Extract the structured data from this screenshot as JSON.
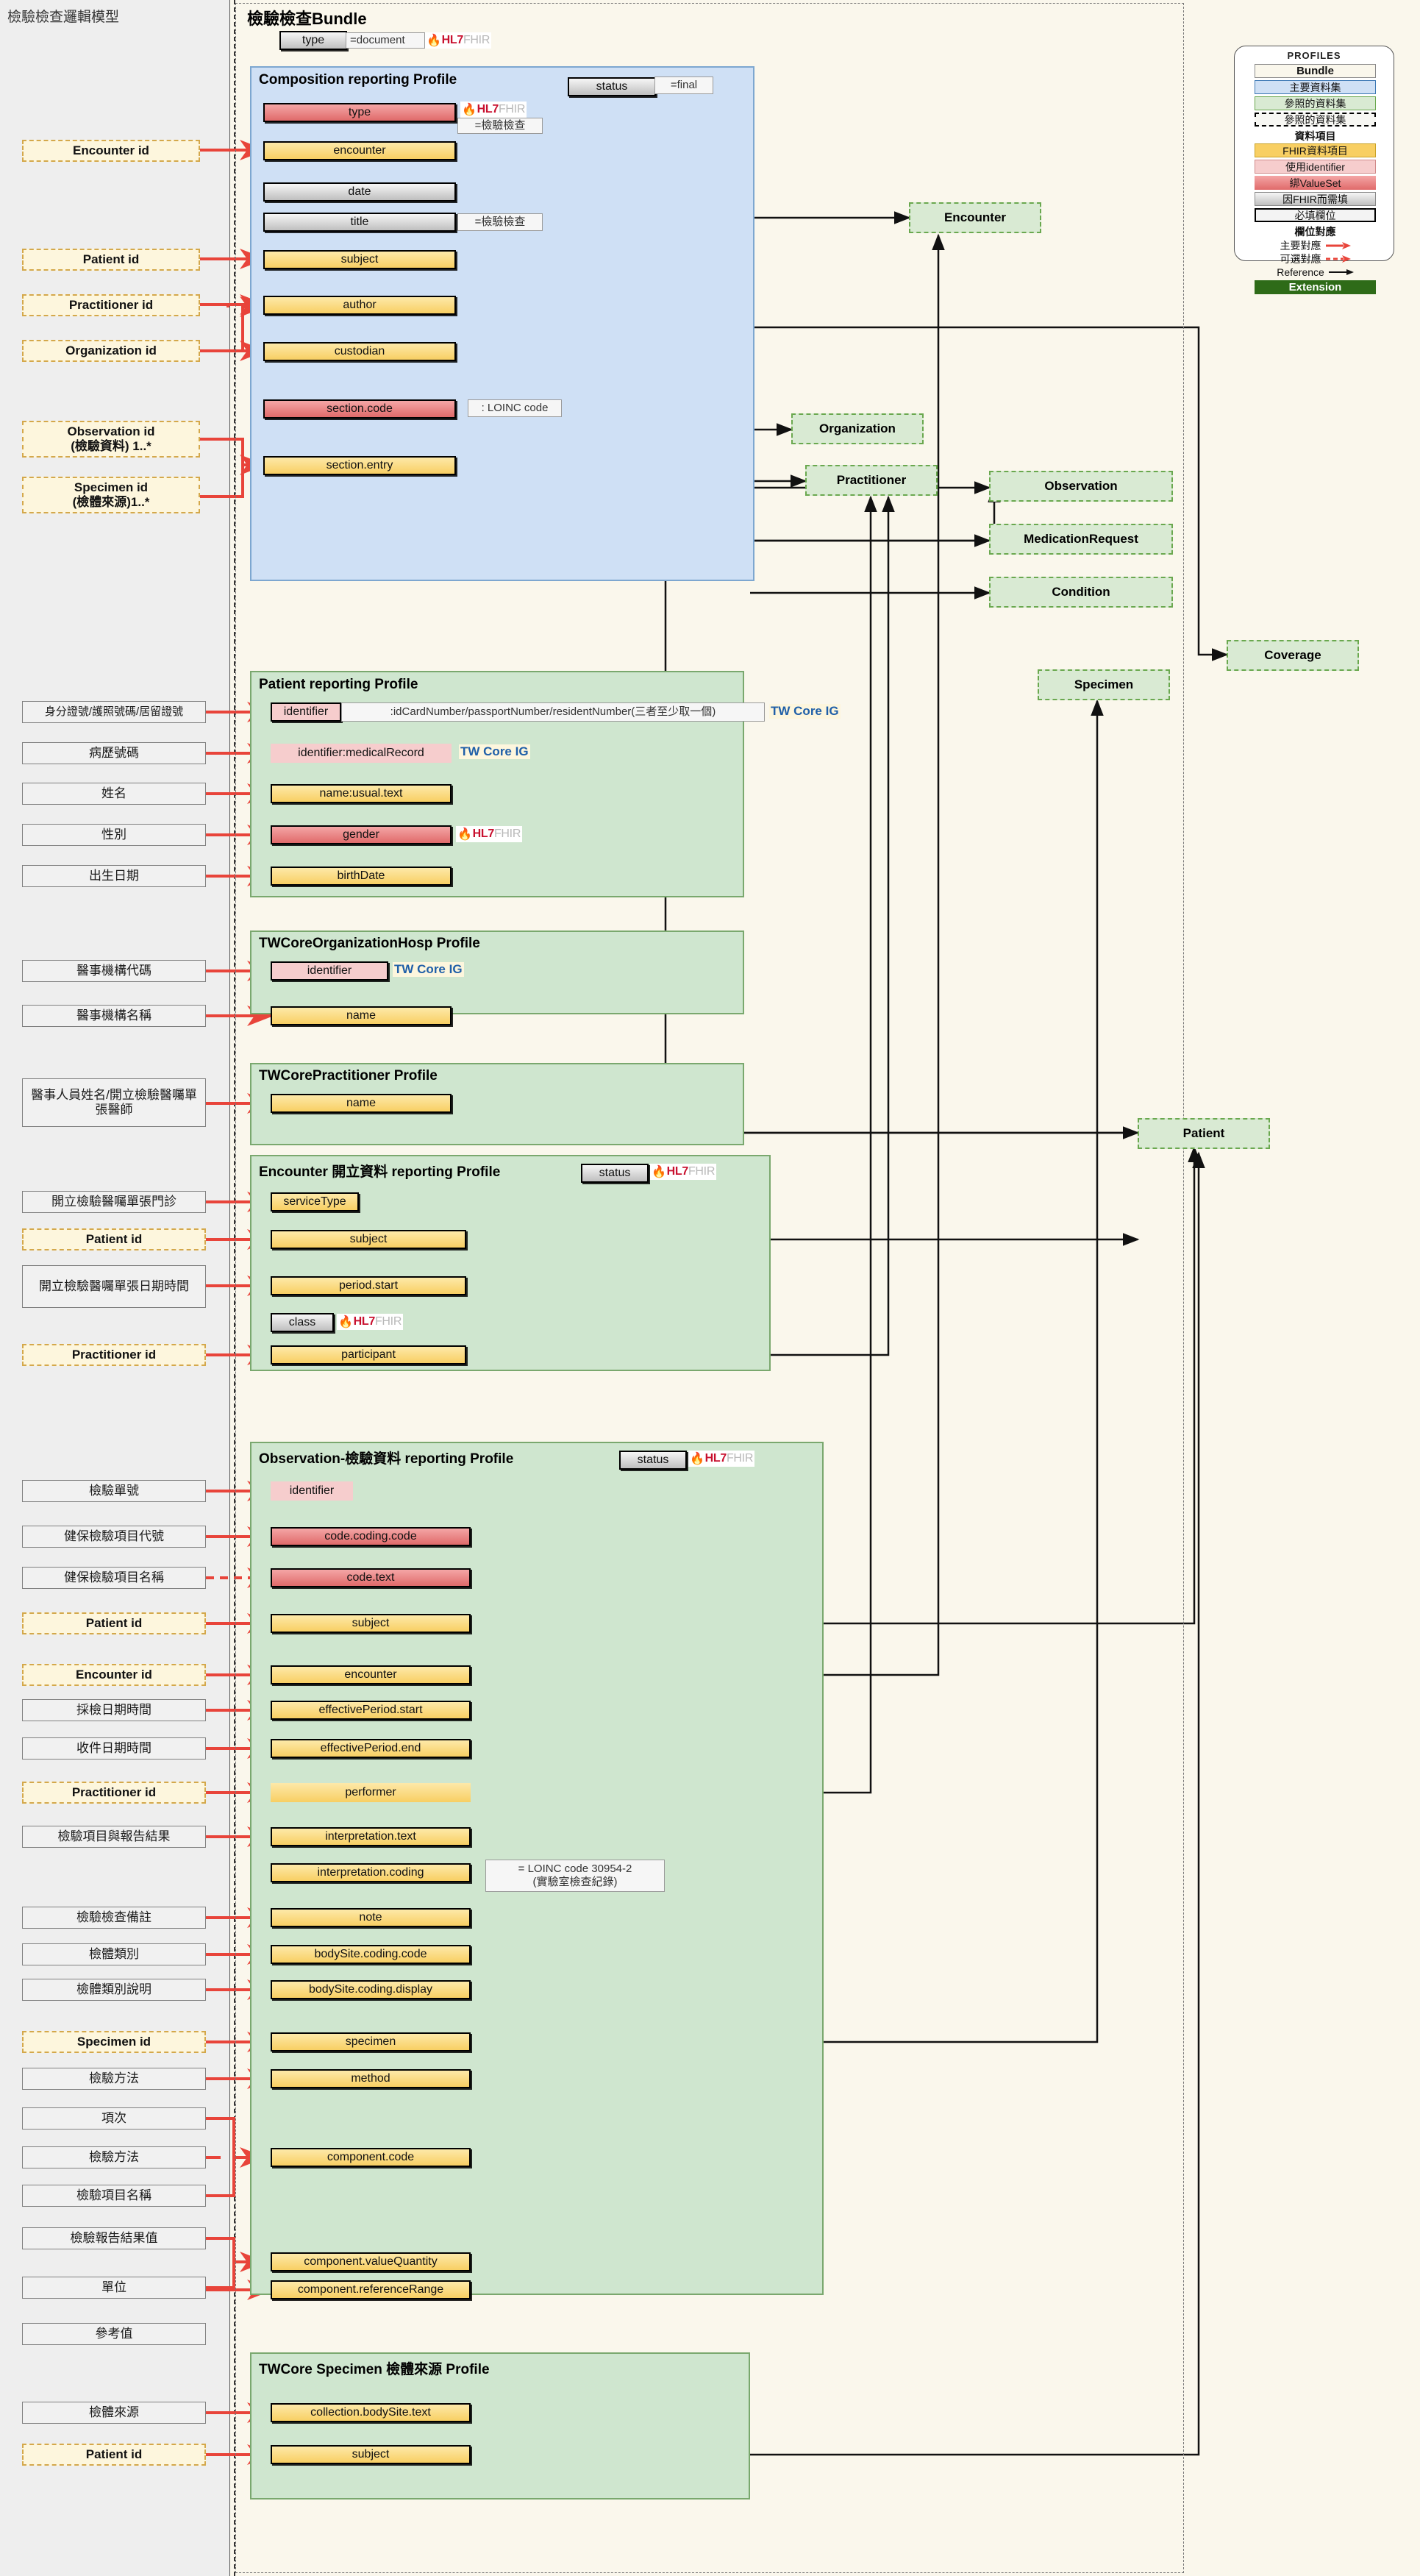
{
  "left_panel": {
    "title": "檢驗檢查邏輯模型"
  },
  "bundle": {
    "title": "檢驗檢查Bundle",
    "type_chip": "type",
    "type_value": "=document",
    "hl7_badge": "HL7 FHIR"
  },
  "legend": {
    "title": "PROFILES",
    "items": [
      {
        "label": "Bundle",
        "style": "bundle"
      },
      {
        "label": "主要資料集",
        "style": "blue"
      },
      {
        "label": "參照的資料集",
        "style": "green"
      },
      {
        "label": "參照的資料集",
        "style": "dashed"
      },
      {
        "label": "資料項目",
        "style": "head"
      },
      {
        "label": "FHIR資料項目",
        "style": "yellow"
      },
      {
        "label": "使用identifier",
        "style": "pink"
      },
      {
        "label": "綁ValueSet",
        "style": "redgrad"
      },
      {
        "label": "因FHIR而需填",
        "style": "greygrad"
      },
      {
        "label": "必填欄位",
        "style": "required"
      },
      {
        "label": "欄位對應",
        "style": "head"
      },
      {
        "label": "主要對應",
        "style": "arrow-solid"
      },
      {
        "label": "可選對應",
        "style": "arrow-dashed"
      },
      {
        "label": "Reference",
        "style": "arrow-plain"
      },
      {
        "label": "Extension",
        "style": "extension"
      }
    ]
  },
  "composition": {
    "title": "Composition reporting Profile",
    "status_chip": "status",
    "status_value": "=final",
    "fields": [
      {
        "name": "type",
        "style": "red",
        "note": "=檢驗檢查",
        "hl7": true
      },
      {
        "name": "encounter",
        "style": "yellow"
      },
      {
        "name": "date",
        "style": "grey"
      },
      {
        "name": "title",
        "style": "grey",
        "note": "=檢驗檢查"
      },
      {
        "name": "subject",
        "style": "yellow"
      },
      {
        "name": "author",
        "style": "yellow"
      },
      {
        "name": "custodian",
        "style": "yellow"
      },
      {
        "name": "section.code",
        "style": "red",
        "note": ": LOINC code"
      },
      {
        "name": "section.entry",
        "style": "yellow"
      }
    ],
    "source_labels": [
      {
        "label": "Encounter id",
        "dashed": true
      },
      {
        "label": "Patient id",
        "dashed": true
      },
      {
        "label": "Practitioner id",
        "dashed": true
      },
      {
        "label": "Organization id",
        "dashed": true
      },
      {
        "label": "Observation id\n(檢驗資料) 1..*",
        "dashed": true
      },
      {
        "label": "Specimen id\n(檢體來源)1..*",
        "dashed": true
      }
    ]
  },
  "references": [
    {
      "label": "Encounter"
    },
    {
      "label": "Organization"
    },
    {
      "label": "Practitioner"
    },
    {
      "label": "Observation"
    },
    {
      "label": "MedicationRequest"
    },
    {
      "label": "Condition"
    },
    {
      "label": "Coverage"
    },
    {
      "label": "Specimen"
    },
    {
      "label": "Patient"
    }
  ],
  "patient_profile": {
    "title": "Patient reporting Profile",
    "rows": [
      {
        "source": "身分證號/護照號碼/居留證號",
        "field": "identifier",
        "style": "pinkhdr",
        "note": ":idCardNumber/passportNumber/residentNumber(三者至少取一個)",
        "twcore": "TW Core IG"
      },
      {
        "source": "病歷號碼",
        "field": "identifier:medicalRecord",
        "style": "pinkflat",
        "twcore": "TW Core IG"
      },
      {
        "source": "姓名",
        "field": "name:usual.text",
        "style": "yellow"
      },
      {
        "source": "性別",
        "field": "gender",
        "style": "red",
        "hl7": true
      },
      {
        "source": "出生日期",
        "field": "birthDate",
        "style": "yellow"
      }
    ]
  },
  "organization_profile": {
    "title": "TWCoreOrganizationHosp Profile",
    "rows": [
      {
        "source": "醫事機構代碼",
        "field": "identifier",
        "style": "pinkhdr",
        "twcore": "TW Core IG"
      },
      {
        "source": "醫事機構名稱",
        "field": "name",
        "style": "yellow"
      }
    ]
  },
  "practitioner_profile": {
    "title": "TWCorePractitioner Profile",
    "rows": [
      {
        "source": "醫事人員姓名/開立檢驗醫囑單張醫師",
        "field": "name",
        "style": "yellow"
      }
    ]
  },
  "encounter_profile": {
    "title": "Encounter 開立資料 reporting Profile",
    "status_chip": "status",
    "rows": [
      {
        "source": "開立檢驗醫囑單張門診",
        "field": "serviceType",
        "style": "yellow"
      },
      {
        "source": "Patient id",
        "dashed": true,
        "field": "subject",
        "style": "yellow"
      },
      {
        "source": "開立檢驗醫囑單張日期時間",
        "field": "period.start",
        "style": "yellow"
      },
      {
        "source": "",
        "field": "class",
        "style": "grey",
        "hl7": true
      },
      {
        "source": "Practitioner id",
        "dashed": true,
        "field": "participant",
        "style": "yellow"
      }
    ]
  },
  "observation_profile": {
    "title": "Observation-檢驗資料 reporting Profile",
    "status_chip": "status",
    "loinc_note": "= LOINC code 30954-2\n(實驗室檢查紀錄)",
    "rows": [
      {
        "source": "檢驗單號",
        "field": "identifier",
        "style": "pinkflat"
      },
      {
        "source": "健保檢驗項目代號",
        "field": "code.coding.code",
        "style": "red"
      },
      {
        "source": "健保檢驗項目名稱",
        "field": "code.text",
        "style": "red",
        "optional": true
      },
      {
        "source": "Patient id",
        "dashed": true,
        "field": "subject",
        "style": "yellow"
      },
      {
        "source": "Encounter id",
        "dashed": true,
        "field": "encounter",
        "style": "yellow"
      },
      {
        "source": "採檢日期時間",
        "field": "effectivePeriod.start",
        "style": "yellow"
      },
      {
        "source": "收件日期時間",
        "field": "effectivePeriod.end",
        "style": "yellow"
      },
      {
        "source": "Practitioner id",
        "dashed": true,
        "field": "performer",
        "style": "yellowflat"
      },
      {
        "source": "檢驗項目與報告結果",
        "field": "interpretation.text",
        "style": "yellow"
      },
      {
        "source": "",
        "field": "interpretation.coding",
        "style": "yellow"
      },
      {
        "source": "檢驗檢查備註",
        "field": "note",
        "style": "yellow"
      },
      {
        "source": "檢體類別",
        "field": "bodySite.coding.code",
        "style": "yellow"
      },
      {
        "source": "檢體類別說明",
        "field": "bodySite.coding.display",
        "style": "yellow"
      },
      {
        "source": "Specimen id",
        "dashed": true,
        "field": "specimen",
        "style": "yellow"
      },
      {
        "source": "檢驗方法",
        "field": "method",
        "style": "yellow"
      },
      {
        "source": "項次",
        "field": "component.code",
        "style": "yellow"
      },
      {
        "source": "檢驗方法",
        "field": "",
        "style": ""
      },
      {
        "source": "檢驗項目名稱",
        "field": "",
        "style": ""
      },
      {
        "source": "檢驗報告結果值",
        "field": "component.valueQuantity",
        "style": "yellow"
      },
      {
        "source": "單位",
        "field": "",
        "style": ""
      },
      {
        "source": "參考值",
        "field": "component.referenceRange",
        "style": "yellow"
      }
    ]
  },
  "specimen_profile": {
    "title": "TWCore Specimen 檢體來源  Profile",
    "rows": [
      {
        "source": "檢體來源",
        "field": "collection.bodySite.text",
        "style": "yellow"
      },
      {
        "source": "Patient id",
        "dashed": true,
        "field": "subject",
        "style": "yellow"
      }
    ]
  }
}
